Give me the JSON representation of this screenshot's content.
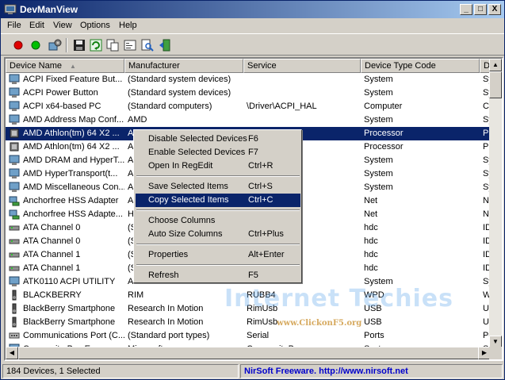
{
  "window": {
    "title": "DevManView",
    "title_icon": "devmanview-app-icon",
    "controls": [
      "_",
      "□",
      "X"
    ]
  },
  "menu": [
    "File",
    "Edit",
    "View",
    "Options",
    "Help"
  ],
  "toolbar": {
    "icons": [
      "red-circle-icon",
      "green-circle-icon",
      "devices-icon",
      "save-icon",
      "refresh-icon",
      "copy-icon",
      "properties-icon",
      "find-icon",
      "exit-icon"
    ]
  },
  "columns": [
    "Device Name",
    "Manufacturer",
    "Service",
    "Device Type Code",
    "De"
  ],
  "rows": [
    {
      "name": "ACPI Fixed Feature But...",
      "mfr": "(Standard system devices)",
      "service": "",
      "type": "System",
      "d": "Sy"
    },
    {
      "name": "ACPI Power Button",
      "mfr": "(Standard system devices)",
      "service": "",
      "type": "System",
      "d": "Sy"
    },
    {
      "name": "ACPI x64-based PC",
      "mfr": "(Standard computers)",
      "service": "\\Driver\\ACPI_HAL",
      "type": "Computer",
      "d": "Co"
    },
    {
      "name": "AMD Address Map Conf...",
      "mfr": "AMD",
      "service": "",
      "type": "System",
      "d": "Sy"
    },
    {
      "name": "AMD Athlon(tm) 64 X2 ...",
      "mfr": "A",
      "service": "",
      "type": "Processor",
      "d": "Pr"
    },
    {
      "name": "AMD Athlon(tm) 64 X2 ...",
      "mfr": "A",
      "service": "",
      "type": "Processor",
      "d": "Pr"
    },
    {
      "name": "AMD DRAM and HyperT...",
      "mfr": "A",
      "service": "",
      "type": "System",
      "d": "Sy"
    },
    {
      "name": "AMD HyperTransport(t...",
      "mfr": "A",
      "service": "",
      "type": "System",
      "d": "Sy"
    },
    {
      "name": "AMD Miscellaneous Con...",
      "mfr": "A",
      "service": "",
      "type": "System",
      "d": "Sy"
    },
    {
      "name": "Anchorfree HSS Adapter",
      "mfr": "A",
      "service": "",
      "type": "Net",
      "d": "Ne"
    },
    {
      "name": "Anchorfree HSS Adapte...",
      "mfr": "H",
      "service": "",
      "type": "Net",
      "d": "Ne"
    },
    {
      "name": "ATA Channel 0",
      "mfr": "(S",
      "service": "",
      "type": "hdc",
      "d": "ID"
    },
    {
      "name": "ATA Channel 0",
      "mfr": "(S",
      "service": "",
      "type": "hdc",
      "d": "ID"
    },
    {
      "name": "ATA Channel 1",
      "mfr": "(S",
      "service": "",
      "type": "hdc",
      "d": "ID"
    },
    {
      "name": "ATA Channel 1",
      "mfr": "(S",
      "service": "",
      "type": "hdc",
      "d": "ID"
    },
    {
      "name": "ATK0110 ACPI UTILITY",
      "mfr": "A",
      "service": "",
      "type": "System",
      "d": "Sy"
    },
    {
      "name": "BLACKBERRY",
      "mfr": "RIM",
      "service": "RUBB4",
      "type": "WPD",
      "d": "W"
    },
    {
      "name": "BlackBerry Smartphone",
      "mfr": "Research In Motion",
      "service": "RimUsb",
      "type": "USB",
      "d": "Un"
    },
    {
      "name": "BlackBerry Smartphone",
      "mfr": "Research In Motion",
      "service": "RimUsb",
      "type": "USB",
      "d": "Un"
    },
    {
      "name": "Communications Port (C...",
      "mfr": "(Standard port types)",
      "service": "Serial",
      "type": "Ports",
      "d": "Po"
    },
    {
      "name": "Composite Bus Enumer...",
      "mfr": "Microsoft",
      "service": "CompositeBus",
      "type": "System",
      "d": "Sy"
    }
  ],
  "context_menu": [
    {
      "label": "Disable Selected Devices",
      "key": "F6"
    },
    {
      "label": "Enable Selected Devices",
      "key": "F7"
    },
    {
      "label": "Open In RegEdit",
      "key": "Ctrl+R"
    },
    {
      "label": "Save Selected Items",
      "key": "Ctrl+S"
    },
    {
      "label": "Copy Selected Items",
      "key": "Ctrl+C"
    },
    {
      "label": "Choose Columns",
      "key": ""
    },
    {
      "label": "Auto Size Columns",
      "key": "Ctrl+Plus"
    },
    {
      "label": "Properties",
      "key": "Alt+Enter"
    },
    {
      "label": "Refresh",
      "key": "F5"
    }
  ],
  "watermark": {
    "title": "Internet Techies",
    "url": "www.ClickonF5.org"
  },
  "status": {
    "count": "184 Devices, 1 Selected",
    "freeware": "NirSoft Freeware.  http://www.nirsoft.net"
  },
  "colors": {
    "selection": "#0a246a",
    "chrome": "#d4d0c8",
    "link": "#0000cc"
  }
}
